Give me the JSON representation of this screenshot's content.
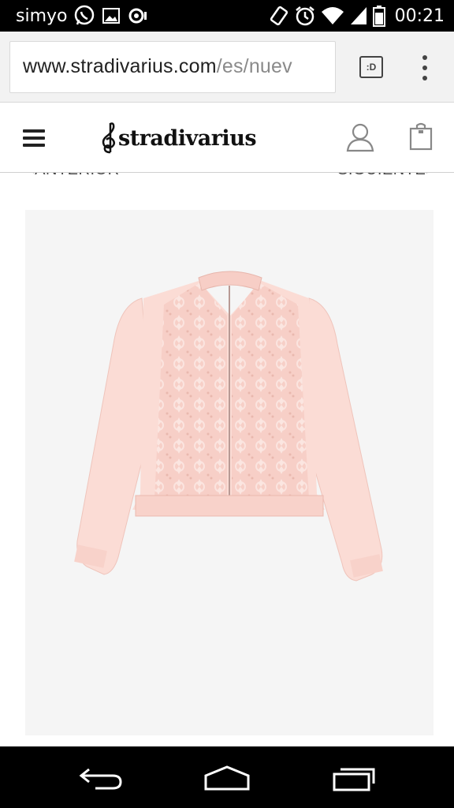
{
  "status_bar": {
    "carrier": "simyo",
    "time": "00:21"
  },
  "browser": {
    "url_domain": "www.stradivarius.com",
    "url_path": "/es/nuev",
    "tabs_label": ":D"
  },
  "site": {
    "logo_text": "stradivarius"
  },
  "pager": {
    "prev": "<ANTERIOR",
    "next": "SIGUIENTE>"
  },
  "product": {
    "image_color": "#f9d6cf"
  },
  "colors": {
    "status_bar_bg": "#000000",
    "url_bar_bg": "#f2f2f2",
    "card_bg": "#f5f5f5",
    "jacket": "#f9d6cf"
  }
}
